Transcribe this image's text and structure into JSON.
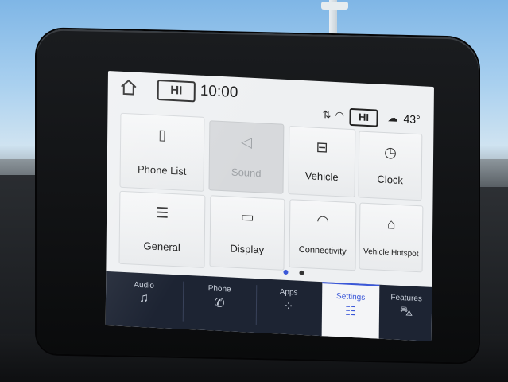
{
  "status_bar": {
    "hvac_left": "HI",
    "time": "10:00",
    "hvac_right": "HI",
    "temperature": "43°"
  },
  "tiles": [
    {
      "label": "Phone List",
      "icon": "phone-list-icon",
      "glyph": "▯",
      "enabled": true
    },
    {
      "label": "Sound",
      "icon": "speaker-icon",
      "glyph": "◁",
      "enabled": false
    },
    {
      "label": "Vehicle",
      "icon": "vehicle-settings-icon",
      "glyph": "⊟",
      "enabled": true
    },
    {
      "label": "Clock",
      "icon": "clock-icon",
      "glyph": "◷",
      "enabled": true
    },
    {
      "label": "General",
      "icon": "sliders-icon",
      "glyph": "☰",
      "enabled": true
    },
    {
      "label": "Display",
      "icon": "display-icon",
      "glyph": "▭",
      "enabled": true
    },
    {
      "label": "Connectivity",
      "icon": "wifi-icon",
      "glyph": "◠",
      "enabled": true
    },
    {
      "label": "Vehicle Hotspot",
      "icon": "car-hotspot-icon",
      "glyph": "⌂",
      "enabled": true
    }
  ],
  "pagination": {
    "current": 1,
    "total": 2,
    "active_color": "#3a57d8",
    "inactive_color": "#333333"
  },
  "nav": [
    {
      "label": "Audio",
      "icon": "music-note-icon",
      "glyph": "♫",
      "active": false
    },
    {
      "label": "Phone",
      "icon": "phone-icon",
      "glyph": "✆",
      "active": false
    },
    {
      "label": "Apps",
      "icon": "apps-grid-icon",
      "glyph": "⁘",
      "active": false
    },
    {
      "label": "Settings",
      "icon": "settings-sliders-icon",
      "glyph": "☷",
      "active": true
    },
    {
      "label": "Features",
      "icon": "car-icon",
      "glyph": "⛍",
      "active": false
    }
  ],
  "colors": {
    "accent": "#3a57d8",
    "nav_bg": "#1d2433"
  }
}
